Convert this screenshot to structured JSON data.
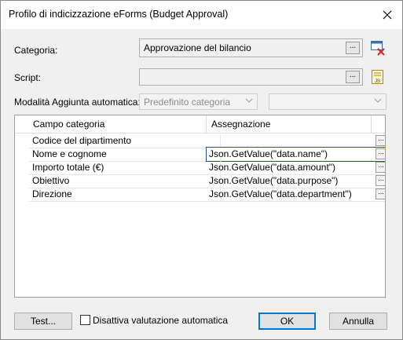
{
  "window": {
    "title": "Profilo di indicizzazione eForms (Budget Approval)"
  },
  "form": {
    "categoria_label": "Categoria:",
    "categoria_value": "Approvazione del bilancio",
    "script_label": "Script:",
    "script_value": "",
    "mode_label": "Modalità Aggiunta automatica:",
    "mode_value": "Predefinito categoria",
    "mode_secondary_value": "",
    "browse_label": "..."
  },
  "grid": {
    "columns": [
      "Campo categoria",
      "Assegnazione"
    ],
    "rows": [
      {
        "field": "Codice del dipartimento",
        "value": ""
      },
      {
        "field": "Nome e cognome",
        "value": "Json.GetValue(\"data.name\")"
      },
      {
        "field": "Importo totale (€)",
        "value": "Json.GetValue(\"data.amount\")"
      },
      {
        "field": "Obiettivo",
        "value": "Json.GetValue(\"data.purpose\")"
      },
      {
        "field": "Direzione",
        "value": "Json.GetValue(\"data.department\")"
      }
    ]
  },
  "footer": {
    "test_label": "Test...",
    "disable_label": "Disattiva valutazione automatica",
    "ok_label": "OK",
    "cancel_label": "Annulla"
  },
  "colors": {
    "accent": "#0078d7",
    "clear_red": "#d9232e"
  },
  "icons": [
    "close-icon",
    "clear-category-icon",
    "script-js-icon",
    "chevron-down-icon"
  ]
}
